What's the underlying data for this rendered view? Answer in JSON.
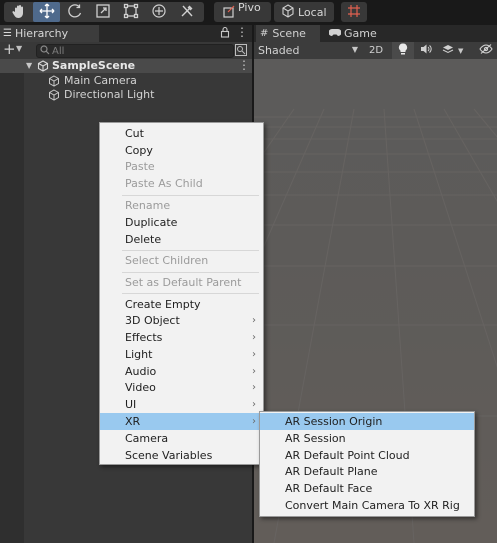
{
  "toolbar": {
    "tools": [
      {
        "icon": "hand-icon"
      },
      {
        "icon": "move-icon",
        "active": true
      },
      {
        "icon": "rotate-icon"
      },
      {
        "icon": "scale-icon"
      },
      {
        "icon": "rect-icon"
      },
      {
        "icon": "transform-icon"
      },
      {
        "icon": "custom-tool-icon"
      }
    ],
    "pivot_label": "Pivo",
    "local_label": "Local",
    "snap_icon": "grid-snap-icon"
  },
  "hierarchy": {
    "tab_label": "Hierarchy",
    "search_placeholder": "All",
    "scene_name": "SampleScene",
    "objects": [
      "Main Camera",
      "Directional Light"
    ]
  },
  "scene_panel": {
    "tabs": [
      "Scene",
      "Game"
    ],
    "shading_mode": "Shaded",
    "mode_2d_label": "2D"
  },
  "context_menu": {
    "groups": [
      [
        {
          "label": "Cut",
          "enabled": true
        },
        {
          "label": "Copy",
          "enabled": true
        },
        {
          "label": "Paste",
          "enabled": false
        },
        {
          "label": "Paste As Child",
          "enabled": false
        }
      ],
      [
        {
          "label": "Rename",
          "enabled": false
        },
        {
          "label": "Duplicate",
          "enabled": true
        },
        {
          "label": "Delete",
          "enabled": true
        }
      ],
      [
        {
          "label": "Select Children",
          "enabled": false
        }
      ],
      [
        {
          "label": "Set as Default Parent",
          "enabled": false
        }
      ],
      [
        {
          "label": "Create Empty",
          "enabled": true,
          "submenu": false
        },
        {
          "label": "3D Object",
          "enabled": true,
          "submenu": true
        },
        {
          "label": "Effects",
          "enabled": true,
          "submenu": true
        },
        {
          "label": "Light",
          "enabled": true,
          "submenu": true
        },
        {
          "label": "Audio",
          "enabled": true,
          "submenu": true
        },
        {
          "label": "Video",
          "enabled": true,
          "submenu": true
        },
        {
          "label": "UI",
          "enabled": true,
          "submenu": true
        },
        {
          "label": "XR",
          "enabled": true,
          "submenu": true,
          "highlighted": true
        },
        {
          "label": "Camera",
          "enabled": true,
          "submenu": false
        },
        {
          "label": "Scene Variables",
          "enabled": true,
          "submenu": false
        }
      ]
    ]
  },
  "xr_submenu": {
    "items": [
      {
        "label": "AR Session Origin",
        "highlighted": true
      },
      {
        "label": "AR Session"
      },
      {
        "label": "AR Default Point Cloud"
      },
      {
        "label": "AR Default Plane"
      },
      {
        "label": "AR Default Face"
      },
      {
        "label": "Convert Main Camera To XR Rig"
      }
    ]
  },
  "colors": {
    "menu_highlight": "#99c9ef",
    "active_tool": "#4f6a8c"
  }
}
